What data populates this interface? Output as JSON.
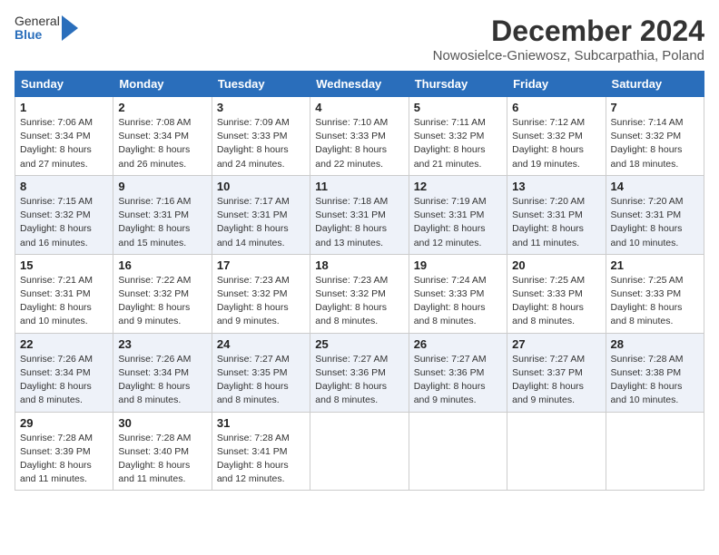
{
  "header": {
    "logo_general": "General",
    "logo_blue": "Blue",
    "month_title": "December 2024",
    "subtitle": "Nowosielce-Gniewosz, Subcarpathia, Poland"
  },
  "columns": [
    "Sunday",
    "Monday",
    "Tuesday",
    "Wednesday",
    "Thursday",
    "Friday",
    "Saturday"
  ],
  "weeks": [
    [
      {
        "day": "1",
        "sunrise": "7:06 AM",
        "sunset": "3:34 PM",
        "daylight": "8 hours and 27 minutes."
      },
      {
        "day": "2",
        "sunrise": "7:08 AM",
        "sunset": "3:34 PM",
        "daylight": "8 hours and 26 minutes."
      },
      {
        "day": "3",
        "sunrise": "7:09 AM",
        "sunset": "3:33 PM",
        "daylight": "8 hours and 24 minutes."
      },
      {
        "day": "4",
        "sunrise": "7:10 AM",
        "sunset": "3:33 PM",
        "daylight": "8 hours and 22 minutes."
      },
      {
        "day": "5",
        "sunrise": "7:11 AM",
        "sunset": "3:32 PM",
        "daylight": "8 hours and 21 minutes."
      },
      {
        "day": "6",
        "sunrise": "7:12 AM",
        "sunset": "3:32 PM",
        "daylight": "8 hours and 19 minutes."
      },
      {
        "day": "7",
        "sunrise": "7:14 AM",
        "sunset": "3:32 PM",
        "daylight": "8 hours and 18 minutes."
      }
    ],
    [
      {
        "day": "8",
        "sunrise": "7:15 AM",
        "sunset": "3:32 PM",
        "daylight": "8 hours and 16 minutes."
      },
      {
        "day": "9",
        "sunrise": "7:16 AM",
        "sunset": "3:31 PM",
        "daylight": "8 hours and 15 minutes."
      },
      {
        "day": "10",
        "sunrise": "7:17 AM",
        "sunset": "3:31 PM",
        "daylight": "8 hours and 14 minutes."
      },
      {
        "day": "11",
        "sunrise": "7:18 AM",
        "sunset": "3:31 PM",
        "daylight": "8 hours and 13 minutes."
      },
      {
        "day": "12",
        "sunrise": "7:19 AM",
        "sunset": "3:31 PM",
        "daylight": "8 hours and 12 minutes."
      },
      {
        "day": "13",
        "sunrise": "7:20 AM",
        "sunset": "3:31 PM",
        "daylight": "8 hours and 11 minutes."
      },
      {
        "day": "14",
        "sunrise": "7:20 AM",
        "sunset": "3:31 PM",
        "daylight": "8 hours and 10 minutes."
      }
    ],
    [
      {
        "day": "15",
        "sunrise": "7:21 AM",
        "sunset": "3:31 PM",
        "daylight": "8 hours and 10 minutes."
      },
      {
        "day": "16",
        "sunrise": "7:22 AM",
        "sunset": "3:32 PM",
        "daylight": "8 hours and 9 minutes."
      },
      {
        "day": "17",
        "sunrise": "7:23 AM",
        "sunset": "3:32 PM",
        "daylight": "8 hours and 9 minutes."
      },
      {
        "day": "18",
        "sunrise": "7:23 AM",
        "sunset": "3:32 PM",
        "daylight": "8 hours and 8 minutes."
      },
      {
        "day": "19",
        "sunrise": "7:24 AM",
        "sunset": "3:33 PM",
        "daylight": "8 hours and 8 minutes."
      },
      {
        "day": "20",
        "sunrise": "7:25 AM",
        "sunset": "3:33 PM",
        "daylight": "8 hours and 8 minutes."
      },
      {
        "day": "21",
        "sunrise": "7:25 AM",
        "sunset": "3:33 PM",
        "daylight": "8 hours and 8 minutes."
      }
    ],
    [
      {
        "day": "22",
        "sunrise": "7:26 AM",
        "sunset": "3:34 PM",
        "daylight": "8 hours and 8 minutes."
      },
      {
        "day": "23",
        "sunrise": "7:26 AM",
        "sunset": "3:34 PM",
        "daylight": "8 hours and 8 minutes."
      },
      {
        "day": "24",
        "sunrise": "7:27 AM",
        "sunset": "3:35 PM",
        "daylight": "8 hours and 8 minutes."
      },
      {
        "day": "25",
        "sunrise": "7:27 AM",
        "sunset": "3:36 PM",
        "daylight": "8 hours and 8 minutes."
      },
      {
        "day": "26",
        "sunrise": "7:27 AM",
        "sunset": "3:36 PM",
        "daylight": "8 hours and 9 minutes."
      },
      {
        "day": "27",
        "sunrise": "7:27 AM",
        "sunset": "3:37 PM",
        "daylight": "8 hours and 9 minutes."
      },
      {
        "day": "28",
        "sunrise": "7:28 AM",
        "sunset": "3:38 PM",
        "daylight": "8 hours and 10 minutes."
      }
    ],
    [
      {
        "day": "29",
        "sunrise": "7:28 AM",
        "sunset": "3:39 PM",
        "daylight": "8 hours and 11 minutes."
      },
      {
        "day": "30",
        "sunrise": "7:28 AM",
        "sunset": "3:40 PM",
        "daylight": "8 hours and 11 minutes."
      },
      {
        "day": "31",
        "sunrise": "7:28 AM",
        "sunset": "3:41 PM",
        "daylight": "8 hours and 12 minutes."
      },
      null,
      null,
      null,
      null
    ]
  ]
}
